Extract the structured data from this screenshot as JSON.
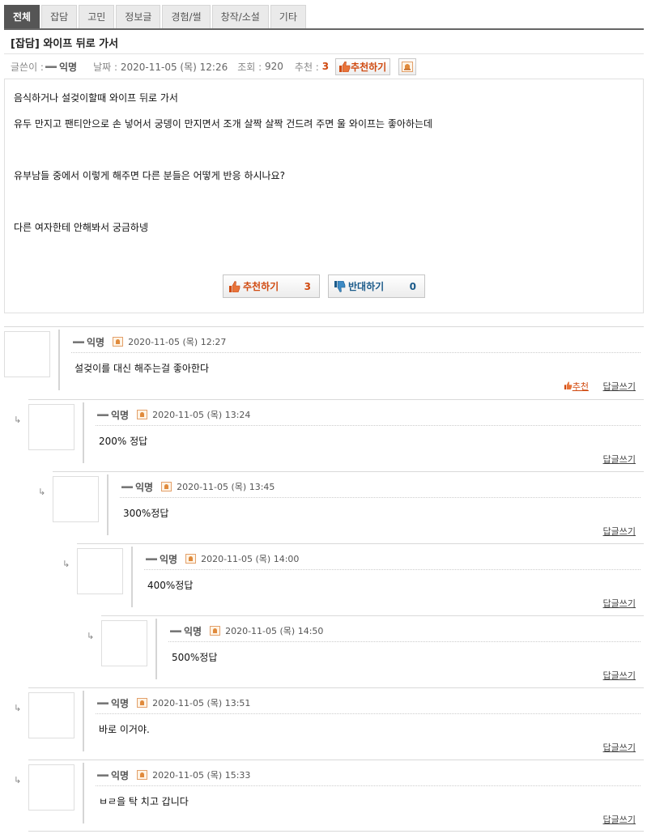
{
  "tabs": [
    "전체",
    "잡담",
    "고민",
    "정보글",
    "경험/썰",
    "창작/소설",
    "기타"
  ],
  "post": {
    "title": "[잡담] 와이프 뒤로 가서",
    "author_label": "글쓴이 :",
    "author": "익명",
    "date_label": "날짜 :",
    "date": "2020-11-05 (목) 12:26",
    "views_label": "조회 :",
    "views": "920",
    "recommend_label": "추천 :",
    "recommend_count": "3",
    "recommend_button": "추천하기",
    "lines": [
      "음식하거나 설겆이할때 와이프 뒤로 가서",
      "유두 만지고 팬티안으로 손 넣어서 궁뎅이 만지면서 조개 살짝 살짝 건드려 주면 울 와이프는 좋아하는데",
      "유부남들 중에서 이렇게 해주면 다른 분들은 어떻게 반응 하시나요?",
      "다른 여자한테 안해봐서 궁금하넹"
    ],
    "vote_up_label": "추천하기",
    "vote_up_count": "3",
    "vote_down_label": "반대하기",
    "vote_down_count": "0"
  },
  "comments": [
    {
      "author": "익명",
      "date": "2020-11-05 (목) 12:27",
      "text": "설겆이를 대신 해주는걸 좋아한다",
      "recommend": "추천",
      "reply": "답글쓰기"
    },
    {
      "author": "익명",
      "date": "2020-11-05 (목) 13:24",
      "text": "200% 정답",
      "reply": "답글쓰기"
    },
    {
      "author": "익명",
      "date": "2020-11-05 (목) 13:45",
      "text": "300%정답",
      "reply": "답글쓰기"
    },
    {
      "author": "익명",
      "date": "2020-11-05 (목) 14:00",
      "text": "400%정답",
      "reply": "답글쓰기"
    },
    {
      "author": "익명",
      "date": "2020-11-05 (목) 14:50",
      "text": "500%정답",
      "reply": "답글쓰기"
    },
    {
      "author": "익명",
      "date": "2020-11-05 (목) 13:51",
      "text": "바로 이거야.",
      "reply": "답글쓰기"
    },
    {
      "author": "익명",
      "date": "2020-11-05 (목) 15:33",
      "text": "ㅂㄹ을 탁 치고 갑니다",
      "reply": "답글쓰기"
    }
  ],
  "reply_arrow": "↳",
  "colors": {
    "accent": "#d04a10",
    "down": "#1a5a8a",
    "tab_active": "#555555"
  }
}
